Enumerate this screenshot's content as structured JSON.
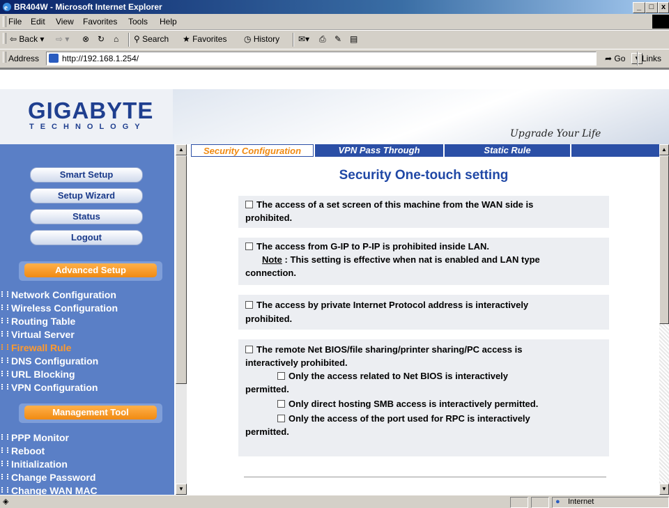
{
  "window": {
    "title": "BR404W - Microsoft Internet Explorer"
  },
  "menu": [
    "File",
    "Edit",
    "View",
    "Favorites",
    "Tools",
    "Help"
  ],
  "toolbar": {
    "back": "Back",
    "search": "Search",
    "favorites": "Favorites",
    "history": "History"
  },
  "address": {
    "label": "Address",
    "url": "http://192.168.1.254/",
    "go": "Go",
    "links": "Links"
  },
  "header": {
    "brand": "GIGABYTE",
    "brand_sub": "TECHNOLOGY",
    "slogan": "Upgrade Your Life"
  },
  "sidebar": {
    "buttons": [
      "Smart Setup",
      "Setup Wizard",
      "Status",
      "Logout"
    ],
    "advanced_title": "Advanced Setup",
    "advanced_items": [
      "Network Configuration",
      "Wireless Configuration",
      "Routing Table",
      "Virtual Server",
      "Firewall Rule",
      "DNS Configuration",
      "URL Blocking",
      "VPN Configuration"
    ],
    "active_item": "Firewall Rule",
    "management_title": "Management Tool",
    "management_items": [
      "PPP Monitor",
      "Reboot",
      "Initialization",
      "Change Password",
      "Change WAN MAC"
    ]
  },
  "tabs": [
    "Security Configuration",
    "VPN Pass Through",
    "Static Rule"
  ],
  "active_tab": "Security Configuration",
  "main": {
    "title": "Security  One-touch setting",
    "opt1_l1": "The access of a set screen of this machine from the WAN side is",
    "opt1_l2": "prohibited.",
    "opt2_l1": "The access from G-IP to P-IP is prohibited inside LAN.",
    "opt2_note_label": "Note",
    "opt2_note": " : This setting is effective when nat is enabled and LAN type",
    "opt2_l3": "connection.",
    "opt3_l1": "The access by private Internet Protocol address is interactively",
    "opt3_l2": "prohibited.",
    "opt4_l1": "The remote Net BIOS/file sharing/printer sharing/PC access is",
    "opt4_l2": "interactively prohibited.",
    "opt4a_l1": "Only the access related to Net BIOS is interactively",
    "opt4a_l2": "permitted.",
    "opt4b": "Only direct hosting SMB access is interactively permitted.",
    "opt4c_l1": "Only the access of the port used for RPC is interactively",
    "opt4c_l2": "permitted."
  },
  "checkboxes": {
    "opt1": false,
    "opt2": false,
    "opt3": false,
    "opt4": false,
    "opt4a": false,
    "opt4b": false,
    "opt4c": false
  },
  "status": {
    "zone": "Internet"
  },
  "colors": {
    "sidebar_bg": "#5a7fc6",
    "accent_orange": "#f08a12",
    "title_blue": "#2048a6",
    "tab_blue": "#2b4fa6"
  }
}
